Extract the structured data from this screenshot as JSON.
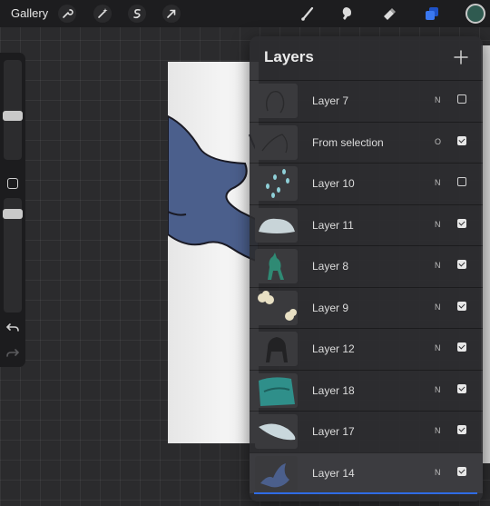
{
  "toolbar": {
    "gallery_label": "Gallery",
    "left_icons": [
      "wrench-icon",
      "magic-wand-icon",
      "selection-icon",
      "transform-arrow-icon"
    ],
    "right_icons": [
      "brush-icon",
      "smudge-icon",
      "eraser-icon",
      "layers-icon"
    ],
    "active_color": "#2f5a50",
    "accent_color": "#2f6be5"
  },
  "sidebar": {
    "icons": [
      "modify-square-icon",
      "undo-icon",
      "redo-icon"
    ]
  },
  "layers_panel": {
    "title": "Layers",
    "add_icon": "plus-icon",
    "layers": [
      {
        "name": "Layer 7",
        "blend": "N",
        "visible": false,
        "selected": false,
        "thumb": "outline-figure"
      },
      {
        "name": "From selection",
        "blend": "O",
        "visible": true,
        "selected": false,
        "thumb": "dark-outline"
      },
      {
        "name": "Layer 10",
        "blend": "N",
        "visible": false,
        "selected": false,
        "thumb": "teal-drops"
      },
      {
        "name": "Layer 11",
        "blend": "N",
        "visible": true,
        "selected": false,
        "thumb": "pale-blob"
      },
      {
        "name": "Layer 8",
        "blend": "N",
        "visible": true,
        "selected": false,
        "thumb": "green-deer"
      },
      {
        "name": "Layer 9",
        "blend": "N",
        "visible": true,
        "selected": false,
        "thumb": "cream-blobs"
      },
      {
        "name": "Layer 12",
        "blend": "N",
        "visible": true,
        "selected": false,
        "thumb": "dark-deer"
      },
      {
        "name": "Layer 18",
        "blend": "N",
        "visible": true,
        "selected": false,
        "thumb": "teal-block"
      },
      {
        "name": "Layer 17",
        "blend": "N",
        "visible": true,
        "selected": false,
        "thumb": "pale-leaf"
      },
      {
        "name": "Layer 14",
        "blend": "N",
        "visible": true,
        "selected": true,
        "thumb": "blue-figure"
      }
    ]
  }
}
